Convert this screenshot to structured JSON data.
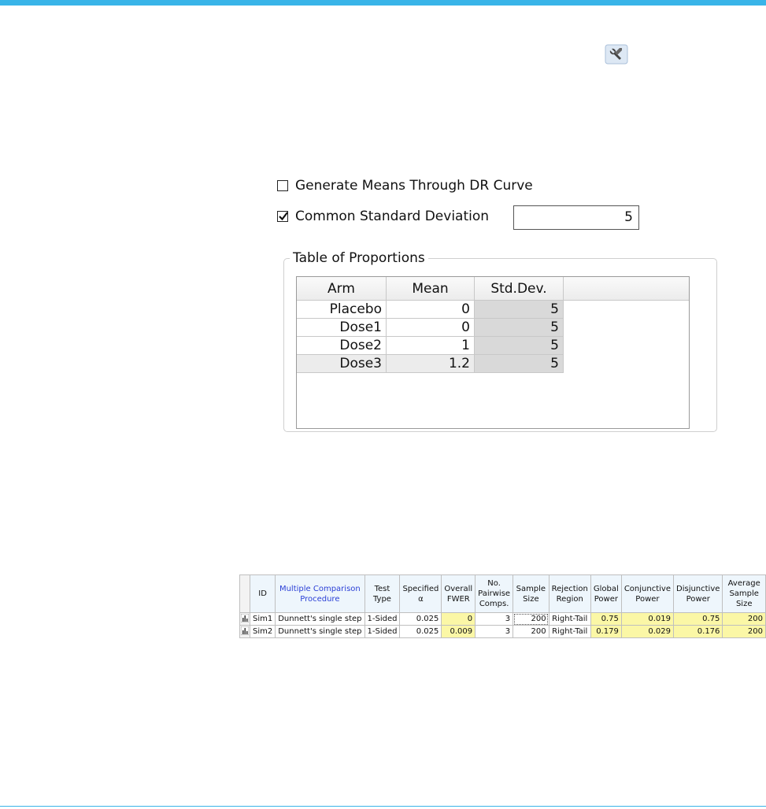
{
  "settings": {
    "generate_means_label": "Generate Means Through DR Curve",
    "generate_means_checked": false,
    "common_sd_label": "Common Standard Deviation",
    "common_sd_checked": true,
    "common_sd_value": "5"
  },
  "proportions": {
    "title": "Table of Proportions",
    "columns": [
      "Arm",
      "Mean",
      "Std.Dev."
    ],
    "rows": [
      {
        "arm": "Placebo",
        "mean": "0",
        "sd": "5"
      },
      {
        "arm": "Dose1",
        "mean": "0",
        "sd": "5"
      },
      {
        "arm": "Dose2",
        "mean": "1",
        "sd": "5"
      },
      {
        "arm": "Dose3",
        "mean": "1.2",
        "sd": "5"
      }
    ]
  },
  "simulations": {
    "headers": {
      "id": "ID",
      "mcp": "Multiple Comparison Procedure",
      "test_type": "Test Type",
      "alpha": "Specified α",
      "fwer": "Overall FWER",
      "npc": "No. Pairwise Comps.",
      "sample_size": "Sample Size",
      "rejection": "Rejection Region",
      "global_power": "Global Power",
      "conj_power": "Conjunctive Power",
      "disj_power": "Disjunctive Power",
      "avg_sample": "Average Sample Size"
    },
    "rows": [
      {
        "id": "Sim1",
        "mcp": "Dunnett's single step",
        "test_type": "1-Sided",
        "alpha": "0.025",
        "fwer": "0",
        "npc": "3",
        "sample_size": "200",
        "rejection": "Right-Tail",
        "global_power": "0.75",
        "conj_power": "0.019",
        "disj_power": "0.75",
        "avg_sample": "200"
      },
      {
        "id": "Sim2",
        "mcp": "Dunnett's single step",
        "test_type": "1-Sided",
        "alpha": "0.025",
        "fwer": "0.009",
        "npc": "3",
        "sample_size": "200",
        "rejection": "Right-Tail",
        "global_power": "0.179",
        "conj_power": "0.029",
        "disj_power": "0.176",
        "avg_sample": "200"
      }
    ]
  },
  "icons": {
    "settings": "wrench-icon",
    "row": "chart-icon"
  },
  "colors": {
    "accent": "#39b4e8",
    "highlight": "#fbf7a6",
    "link": "#2a3fd6"
  }
}
